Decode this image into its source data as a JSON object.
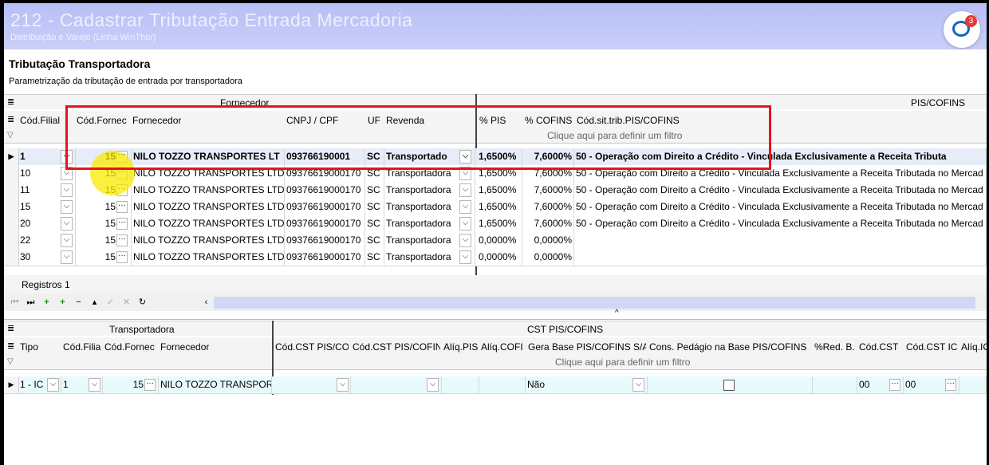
{
  "window": {
    "title": "212 - Cadastrar Tributação Entrada Mercadoria",
    "subtitle": "Distribuição e Varejo (Linha WinThor)",
    "chat_badge": "3"
  },
  "header": {
    "title": "Tributação Transportadora",
    "description": "Parametrização da tributação de entrada por transportadora"
  },
  "top_grid": {
    "band_fornecedor": "Fornecedor",
    "band_piscofins": "PIS/COFINS",
    "columns": {
      "cod_filial": "Cód.Filial",
      "cod_fornec": "Cód.Fornec",
      "fornecedor": "Fornecedor",
      "cnpj": "CNPJ / CPF",
      "uf": "UF",
      "revenda": "Revenda",
      "pis": "% PIS",
      "cofins": "% COFINS",
      "cod_sit": "Cód.sit.trib.PIS/COFINS"
    },
    "filter_hint": "Clique aqui para definir um filtro",
    "rows": [
      {
        "filial": "1",
        "fornec": "15",
        "nome": "NILO TOZZO TRANSPORTES LT",
        "cnpj": "093766190001",
        "uf": "SC",
        "revenda": "Transportado",
        "pis": "1,6500%",
        "cofins": "7,6000%",
        "sit": "50 - Operação com Direito a Crédito - Vinculada Exclusivamente a Receita Tributa"
      },
      {
        "filial": "10",
        "fornec": "15",
        "nome": "NILO TOZZO TRANSPORTES LTDA",
        "cnpj": "09376619000170",
        "uf": "SC",
        "revenda": "Transportadora",
        "pis": "1,6500%",
        "cofins": "7,6000%",
        "sit": "50 - Operação com Direito a Crédito - Vinculada Exclusivamente a Receita Tributada no Mercad"
      },
      {
        "filial": "11",
        "fornec": "15",
        "nome": "NILO TOZZO TRANSPORTES LTDA",
        "cnpj": "09376619000170",
        "uf": "SC",
        "revenda": "Transportadora",
        "pis": "1,6500%",
        "cofins": "7,6000%",
        "sit": "50 - Operação com Direito a Crédito - Vinculada Exclusivamente a Receita Tributada no Mercad"
      },
      {
        "filial": "15",
        "fornec": "15",
        "nome": "NILO TOZZO TRANSPORTES LTDA",
        "cnpj": "09376619000170",
        "uf": "SC",
        "revenda": "Transportadora",
        "pis": "1,6500%",
        "cofins": "7,6000%",
        "sit": "50 - Operação com Direito a Crédito - Vinculada Exclusivamente a Receita Tributada no Mercad"
      },
      {
        "filial": "20",
        "fornec": "15",
        "nome": "NILO TOZZO TRANSPORTES LTDA",
        "cnpj": "09376619000170",
        "uf": "SC",
        "revenda": "Transportadora",
        "pis": "1,6500%",
        "cofins": "7,6000%",
        "sit": "50 - Operação com Direito a Crédito - Vinculada Exclusivamente a Receita Tributada no Mercad"
      },
      {
        "filial": "22",
        "fornec": "15",
        "nome": "NILO TOZZO TRANSPORTES LTDA",
        "cnpj": "09376619000170",
        "uf": "SC",
        "revenda": "Transportadora",
        "pis": "0,0000%",
        "cofins": "0,0000%",
        "sit": ""
      },
      {
        "filial": "30",
        "fornec": "15",
        "nome": "NILO TOZZO TRANSPORTES LTDA",
        "cnpj": "09376619000170",
        "uf": "SC",
        "revenda": "Transportadora",
        "pis": "0,0000%",
        "cofins": "0,0000%",
        "sit": ""
      }
    ],
    "status": "Registros 1"
  },
  "bottom_grid": {
    "band_transportadora": "Transportadora",
    "band_cst": "CST PIS/COFINS",
    "columns": {
      "tipo": "Tipo",
      "cod_filial": "Cód.Filia",
      "cod_fornec": "Cód.Fornec",
      "fornecedor": "Fornecedor",
      "cst_pis_co": "Cód.CST PIS/CO",
      "cst_pis_cofin": "Cód.CST PIS/COFIN",
      "aliq_pis": "Alíq.PIS",
      "aliq_cofi": "Alíq.COFI",
      "gera_base": "Gera Base PIS/COFINS S/A",
      "cons_pedagio": "Cons. Pedágio na Base PIS/COFINS",
      "red_b": "%Red. B.",
      "cod_cst": "Cód.CST",
      "cod_cst_ic": "Cód.CST IC",
      "aliq_ic": "Alíq.IC"
    },
    "filter_hint": "Clique aqui para definir um filtro",
    "row": {
      "tipo": "1 - IC",
      "filial": "1",
      "fornec": "15",
      "nome": "NILO TOZZO TRANSPORT",
      "gera_base": "Não",
      "cod_cst": "00",
      "cod_cst_ic": "00"
    }
  }
}
